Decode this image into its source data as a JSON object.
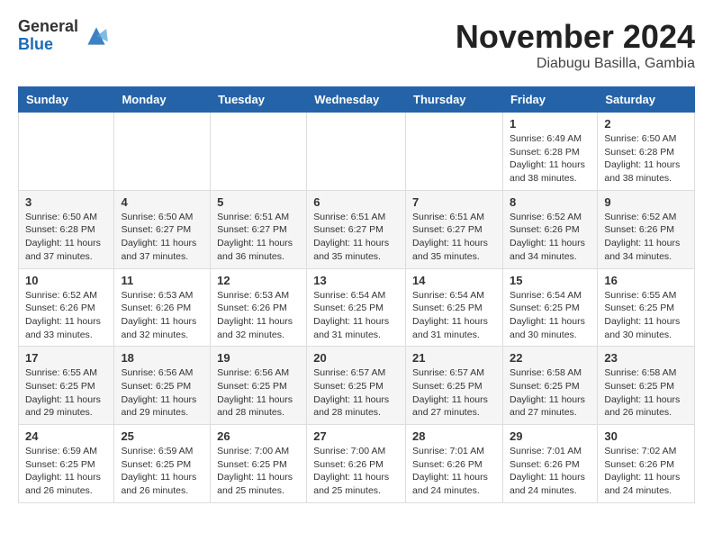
{
  "logo": {
    "general": "General",
    "blue": "Blue"
  },
  "title": "November 2024",
  "location": "Diabugu Basilla, Gambia",
  "weekdays": [
    "Sunday",
    "Monday",
    "Tuesday",
    "Wednesday",
    "Thursday",
    "Friday",
    "Saturday"
  ],
  "weeks": [
    [
      {
        "day": "",
        "info": ""
      },
      {
        "day": "",
        "info": ""
      },
      {
        "day": "",
        "info": ""
      },
      {
        "day": "",
        "info": ""
      },
      {
        "day": "",
        "info": ""
      },
      {
        "day": "1",
        "info": "Sunrise: 6:49 AM\nSunset: 6:28 PM\nDaylight: 11 hours\nand 38 minutes."
      },
      {
        "day": "2",
        "info": "Sunrise: 6:50 AM\nSunset: 6:28 PM\nDaylight: 11 hours\nand 38 minutes."
      }
    ],
    [
      {
        "day": "3",
        "info": "Sunrise: 6:50 AM\nSunset: 6:28 PM\nDaylight: 11 hours\nand 37 minutes."
      },
      {
        "day": "4",
        "info": "Sunrise: 6:50 AM\nSunset: 6:27 PM\nDaylight: 11 hours\nand 37 minutes."
      },
      {
        "day": "5",
        "info": "Sunrise: 6:51 AM\nSunset: 6:27 PM\nDaylight: 11 hours\nand 36 minutes."
      },
      {
        "day": "6",
        "info": "Sunrise: 6:51 AM\nSunset: 6:27 PM\nDaylight: 11 hours\nand 35 minutes."
      },
      {
        "day": "7",
        "info": "Sunrise: 6:51 AM\nSunset: 6:27 PM\nDaylight: 11 hours\nand 35 minutes."
      },
      {
        "day": "8",
        "info": "Sunrise: 6:52 AM\nSunset: 6:26 PM\nDaylight: 11 hours\nand 34 minutes."
      },
      {
        "day": "9",
        "info": "Sunrise: 6:52 AM\nSunset: 6:26 PM\nDaylight: 11 hours\nand 34 minutes."
      }
    ],
    [
      {
        "day": "10",
        "info": "Sunrise: 6:52 AM\nSunset: 6:26 PM\nDaylight: 11 hours\nand 33 minutes."
      },
      {
        "day": "11",
        "info": "Sunrise: 6:53 AM\nSunset: 6:26 PM\nDaylight: 11 hours\nand 32 minutes."
      },
      {
        "day": "12",
        "info": "Sunrise: 6:53 AM\nSunset: 6:26 PM\nDaylight: 11 hours\nand 32 minutes."
      },
      {
        "day": "13",
        "info": "Sunrise: 6:54 AM\nSunset: 6:25 PM\nDaylight: 11 hours\nand 31 minutes."
      },
      {
        "day": "14",
        "info": "Sunrise: 6:54 AM\nSunset: 6:25 PM\nDaylight: 11 hours\nand 31 minutes."
      },
      {
        "day": "15",
        "info": "Sunrise: 6:54 AM\nSunset: 6:25 PM\nDaylight: 11 hours\nand 30 minutes."
      },
      {
        "day": "16",
        "info": "Sunrise: 6:55 AM\nSunset: 6:25 PM\nDaylight: 11 hours\nand 30 minutes."
      }
    ],
    [
      {
        "day": "17",
        "info": "Sunrise: 6:55 AM\nSunset: 6:25 PM\nDaylight: 11 hours\nand 29 minutes."
      },
      {
        "day": "18",
        "info": "Sunrise: 6:56 AM\nSunset: 6:25 PM\nDaylight: 11 hours\nand 29 minutes."
      },
      {
        "day": "19",
        "info": "Sunrise: 6:56 AM\nSunset: 6:25 PM\nDaylight: 11 hours\nand 28 minutes."
      },
      {
        "day": "20",
        "info": "Sunrise: 6:57 AM\nSunset: 6:25 PM\nDaylight: 11 hours\nand 28 minutes."
      },
      {
        "day": "21",
        "info": "Sunrise: 6:57 AM\nSunset: 6:25 PM\nDaylight: 11 hours\nand 27 minutes."
      },
      {
        "day": "22",
        "info": "Sunrise: 6:58 AM\nSunset: 6:25 PM\nDaylight: 11 hours\nand 27 minutes."
      },
      {
        "day": "23",
        "info": "Sunrise: 6:58 AM\nSunset: 6:25 PM\nDaylight: 11 hours\nand 26 minutes."
      }
    ],
    [
      {
        "day": "24",
        "info": "Sunrise: 6:59 AM\nSunset: 6:25 PM\nDaylight: 11 hours\nand 26 minutes."
      },
      {
        "day": "25",
        "info": "Sunrise: 6:59 AM\nSunset: 6:25 PM\nDaylight: 11 hours\nand 26 minutes."
      },
      {
        "day": "26",
        "info": "Sunrise: 7:00 AM\nSunset: 6:25 PM\nDaylight: 11 hours\nand 25 minutes."
      },
      {
        "day": "27",
        "info": "Sunrise: 7:00 AM\nSunset: 6:26 PM\nDaylight: 11 hours\nand 25 minutes."
      },
      {
        "day": "28",
        "info": "Sunrise: 7:01 AM\nSunset: 6:26 PM\nDaylight: 11 hours\nand 24 minutes."
      },
      {
        "day": "29",
        "info": "Sunrise: 7:01 AM\nSunset: 6:26 PM\nDaylight: 11 hours\nand 24 minutes."
      },
      {
        "day": "30",
        "info": "Sunrise: 7:02 AM\nSunset: 6:26 PM\nDaylight: 11 hours\nand 24 minutes."
      }
    ]
  ]
}
